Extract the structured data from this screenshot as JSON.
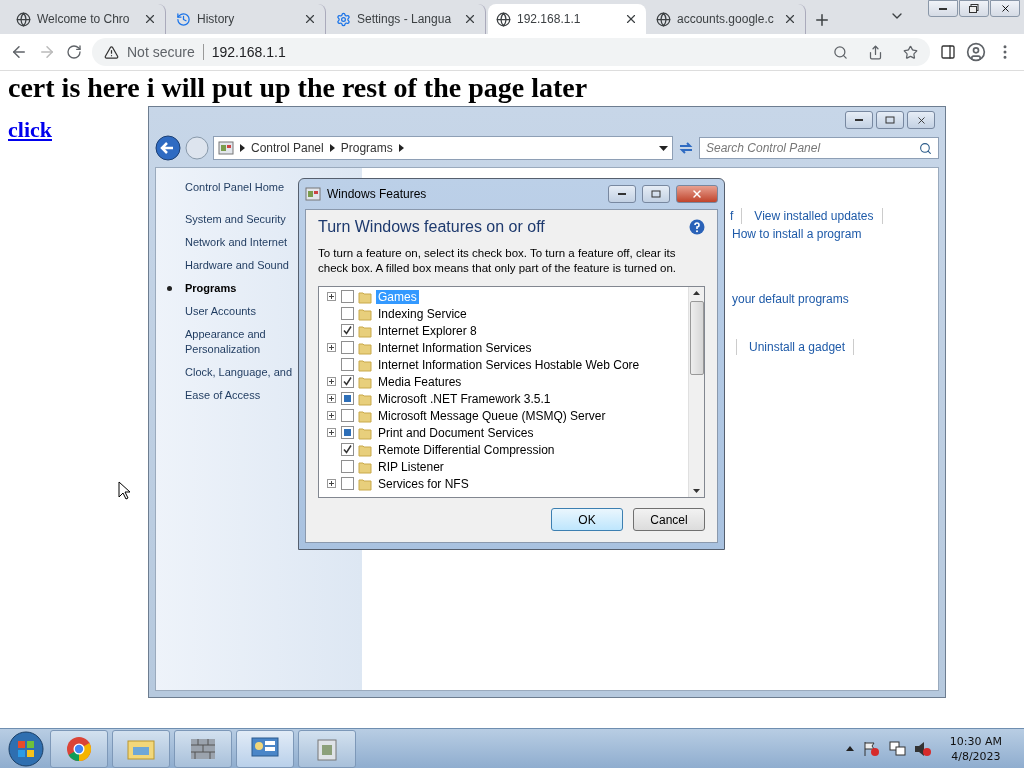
{
  "browser": {
    "tabs": [
      {
        "title": "Welcome to Chro",
        "kind": "globe",
        "selected": false
      },
      {
        "title": "History",
        "kind": "history",
        "selected": false
      },
      {
        "title": "Settings - Langua",
        "kind": "gear",
        "selected": false
      },
      {
        "title": "192.168.1.1",
        "kind": "globe",
        "selected": true
      },
      {
        "title": "accounts.google.c",
        "kind": "globe",
        "selected": false
      }
    ],
    "security": "Not secure",
    "url": "192.168.1.1"
  },
  "page": {
    "heading": "cert is here i will put up the rest of the page later",
    "link": "click"
  },
  "control_panel": {
    "breadcrumb": [
      "Control Panel",
      "Programs"
    ],
    "search": {
      "placeholder": "Search Control Panel"
    },
    "nav": [
      {
        "label": "Control Panel Home",
        "selected": false
      },
      {
        "label": "System and Security",
        "selected": false
      },
      {
        "label": "Network and Internet",
        "selected": false
      },
      {
        "label": "Hardware and Sound",
        "selected": false
      },
      {
        "label": "Programs",
        "selected": true
      },
      {
        "label": "User Accounts",
        "selected": false
      },
      {
        "label": "Appearance and Personalization",
        "selected": false
      },
      {
        "label": "Clock, Language, and",
        "selected": false
      },
      {
        "label": "Ease of Access",
        "selected": false
      }
    ],
    "link_rows": [
      [
        "f",
        "View installed updates"
      ],
      [
        "How to install a program"
      ],
      [
        "your default programs"
      ],
      [
        "Uninstall a gadget"
      ]
    ]
  },
  "dialog": {
    "title": "Windows Features",
    "heading": "Turn Windows features on or off",
    "description": "To turn a feature on, select its check box. To turn a feature off, clear its check box. A filled box means that only part of the feature is turned on.",
    "features": [
      {
        "label": "Games",
        "expandable": true,
        "checked": false,
        "partial": false,
        "selected": true
      },
      {
        "label": "Indexing Service",
        "expandable": false,
        "checked": false,
        "partial": false,
        "selected": false
      },
      {
        "label": "Internet Explorer 8",
        "expandable": false,
        "checked": true,
        "partial": false,
        "selected": false
      },
      {
        "label": "Internet Information Services",
        "expandable": true,
        "checked": false,
        "partial": false,
        "selected": false
      },
      {
        "label": "Internet Information Services Hostable Web Core",
        "expandable": false,
        "checked": false,
        "partial": false,
        "selected": false
      },
      {
        "label": "Media Features",
        "expandable": true,
        "checked": true,
        "partial": false,
        "selected": false
      },
      {
        "label": "Microsoft .NET Framework 3.5.1",
        "expandable": true,
        "checked": false,
        "partial": true,
        "selected": false
      },
      {
        "label": "Microsoft Message Queue (MSMQ) Server",
        "expandable": true,
        "checked": false,
        "partial": false,
        "selected": false
      },
      {
        "label": "Print and Document Services",
        "expandable": true,
        "checked": false,
        "partial": true,
        "selected": false
      },
      {
        "label": "Remote Differential Compression",
        "expandable": false,
        "checked": true,
        "partial": false,
        "selected": false
      },
      {
        "label": "RIP Listener",
        "expandable": false,
        "checked": false,
        "partial": false,
        "selected": false
      },
      {
        "label": "Services for NFS",
        "expandable": true,
        "checked": false,
        "partial": false,
        "selected": false
      }
    ],
    "buttons": [
      {
        "label": "OK",
        "default": true
      },
      {
        "label": "Cancel",
        "default": false
      }
    ]
  },
  "taskbar": {
    "time": "10:30 AM",
    "date": "4/8/2023"
  }
}
